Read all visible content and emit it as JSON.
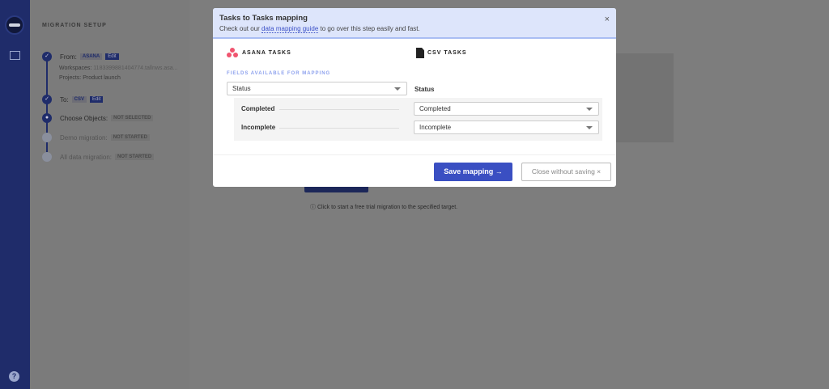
{
  "sidebar": {
    "title": "MIGRATION SETUP",
    "from": {
      "label": "From:",
      "tag": "ASANA",
      "edit": "Edit",
      "workspaces_label": "Workspaces:",
      "workspaces_value": "1183399881404774.tallnws.asa...",
      "projects_label": "Projects:",
      "projects_value": "Product launch"
    },
    "to": {
      "label": "To:",
      "tag": "CSV",
      "edit": "Edit"
    },
    "choose": {
      "label": "Choose Objects:",
      "status": "NOT SELECTED"
    },
    "demo": {
      "label": "Demo migration:",
      "status": "NOT STARTED"
    },
    "all": {
      "label": "All data migration:",
      "status": "NOT STARTED"
    }
  },
  "main": {
    "hint": "Click to start a free trial migration to the specified target.",
    "hint_icon": "info-icon"
  },
  "modal": {
    "title": "Tasks to Tasks mapping",
    "subtitle_pre": "Check out our ",
    "subtitle_link": "data mapping guide",
    "subtitle_post": " to go over this step easily and fast.",
    "source": "ASANA TASKS",
    "target": "CSV TASKS",
    "fields_label": "FIELDS AVAILABLE FOR MAPPING",
    "source_field": "Status",
    "target_field": "Status",
    "rows": [
      {
        "source": "Completed",
        "target": "Completed"
      },
      {
        "source": "Incomplete",
        "target": "Incomplete"
      }
    ],
    "save": "Save mapping →",
    "close": "Close without saving ×"
  },
  "colors": {
    "accent": "#3a4fc2",
    "header_bg": "#dde5fb",
    "asana": "#f0546f"
  }
}
